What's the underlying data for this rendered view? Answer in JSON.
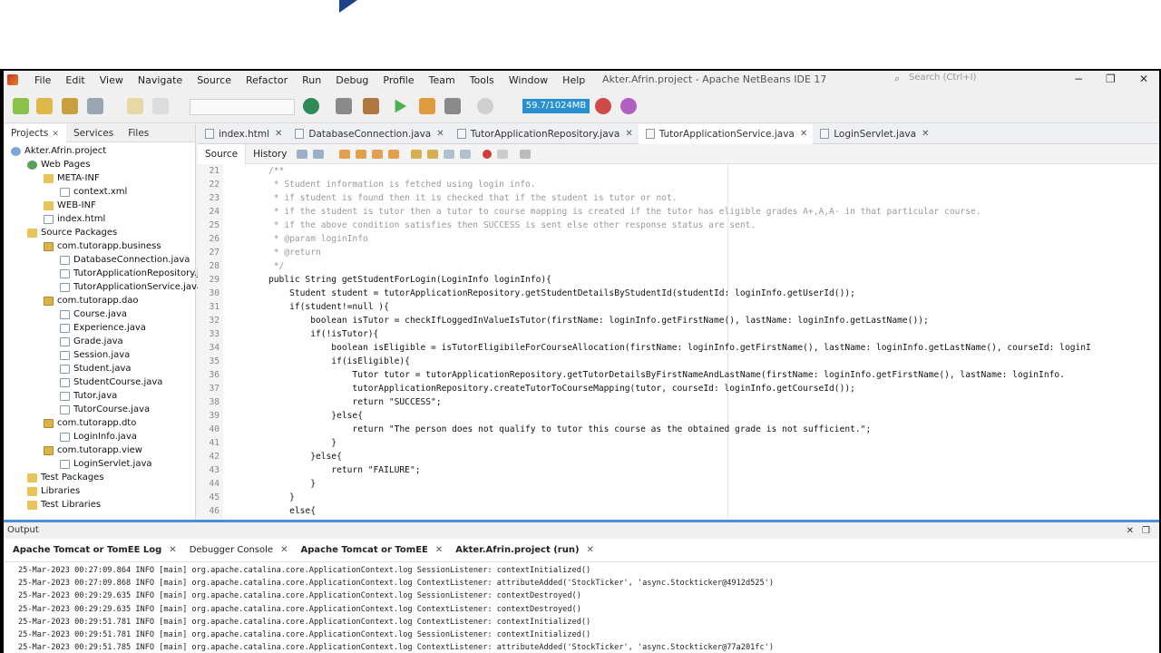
{
  "window": {
    "title": "Akter.Afrin.project - Apache NetBeans IDE 17",
    "search_placeholder": "Search (Ctrl+I)",
    "minimize": "−",
    "maximize": "❐",
    "close": "✕"
  },
  "menu": [
    "File",
    "Edit",
    "View",
    "Navigate",
    "Source",
    "Refactor",
    "Run",
    "Debug",
    "Profile",
    "Team",
    "Tools",
    "Window",
    "Help"
  ],
  "toolbar": {
    "memory": "59.7/1024MB"
  },
  "projects_panel": {
    "tabs": [
      "Projects",
      "Services",
      "Files"
    ],
    "tree": [
      {
        "label": "Akter.Afrin.project",
        "icon": "proj"
      },
      {
        "label": "Web Pages",
        "icon": "web"
      },
      {
        "label": "META-INF",
        "icon": "folder"
      },
      {
        "label": "context.xml",
        "icon": "file"
      },
      {
        "label": "WEB-INF",
        "icon": "folder"
      },
      {
        "label": "index.html",
        "icon": "file"
      },
      {
        "label": "Source Packages",
        "icon": "folder"
      },
      {
        "label": "com.tutorapp.business",
        "icon": "pkg"
      },
      {
        "label": "DatabaseConnection.java",
        "icon": "file"
      },
      {
        "label": "TutorApplicationRepository.ja",
        "icon": "file"
      },
      {
        "label": "TutorApplicationService.java",
        "icon": "file"
      },
      {
        "label": "com.tutorapp.dao",
        "icon": "pkg"
      },
      {
        "label": "Course.java",
        "icon": "file"
      },
      {
        "label": "Experience.java",
        "icon": "file"
      },
      {
        "label": "Grade.java",
        "icon": "file"
      },
      {
        "label": "Session.java",
        "icon": "file"
      },
      {
        "label": "Student.java",
        "icon": "file"
      },
      {
        "label": "StudentCourse.java",
        "icon": "file"
      },
      {
        "label": "Tutor.java",
        "icon": "file"
      },
      {
        "label": "TutorCourse.java",
        "icon": "file"
      },
      {
        "label": "com.tutorapp.dto",
        "icon": "pkg"
      },
      {
        "label": "LoginInfo.java",
        "icon": "file"
      },
      {
        "label": "com.tutorapp.view",
        "icon": "pkg"
      },
      {
        "label": "LoginServlet.java",
        "icon": "file"
      },
      {
        "label": "Test Packages",
        "icon": "folder"
      },
      {
        "label": "Libraries",
        "icon": "folder"
      },
      {
        "label": "Test Libraries",
        "icon": "folder"
      }
    ]
  },
  "editor": {
    "tabs": [
      "index.html",
      "DatabaseConnection.java",
      "TutorApplicationRepository.java",
      "TutorApplicationService.java",
      "LoginServlet.java"
    ],
    "active_tab": 3,
    "source_label": "Source",
    "history_label": "History",
    "lines": [
      {
        "n": "21",
        "t": "/**",
        "c": true
      },
      {
        "n": "22",
        "t": " * Student information is fetched using login info.",
        "c": true
      },
      {
        "n": "23",
        "t": " * if student is found then it is checked that if the student is tutor or not.",
        "c": true
      },
      {
        "n": "24",
        "t": " * if the student is tutor then a tutor to course mapping is created if the tutor has eligible grades A+,A,A- in that particular course.",
        "c": true
      },
      {
        "n": "25",
        "t": " * if the above condition satisfies then SUCCESS is sent else other response status are sent.",
        "c": true
      },
      {
        "n": "26",
        "t": " * @param loginInfo",
        "c": true
      },
      {
        "n": "27",
        "t": " * @return",
        "c": true
      },
      {
        "n": "28",
        "t": " */",
        "c": true
      },
      {
        "n": "29",
        "t": "public String getStudentForLogin(LoginInfo loginInfo){",
        "c": false
      },
      {
        "n": "30",
        "t": "    Student student = tutorApplicationRepository.getStudentDetailsByStudentId(studentId: loginInfo.getUserId());",
        "c": false
      },
      {
        "n": "31",
        "t": "    if(student!=null ){",
        "c": false
      },
      {
        "n": "32",
        "t": "        boolean isTutor = checkIfLoggedInValueIsTutor(firstName: loginInfo.getFirstName(), lastName: loginInfo.getLastName());",
        "c": false
      },
      {
        "n": "33",
        "t": "        if(!isTutor){",
        "c": false
      },
      {
        "n": "34",
        "t": "            boolean isEligible = isTutorEligibileForCourseAllocation(firstName: loginInfo.getFirstName(), lastName: loginInfo.getLastName(), courseId: loginI",
        "c": false
      },
      {
        "n": "35",
        "t": "            if(isEligible){",
        "c": false
      },
      {
        "n": "36",
        "t": "                Tutor tutor = tutorApplicationRepository.getTutorDetailsByFirstNameAndLastName(firstName: loginInfo.getFirstName(), lastName: loginInfo.",
        "c": false
      },
      {
        "n": "37",
        "t": "                tutorApplicationRepository.createTutorToCourseMapping(tutor, courseId: loginInfo.getCourseId());",
        "c": false
      },
      {
        "n": "38",
        "t": "                return \"SUCCESS\";",
        "c": false
      },
      {
        "n": "39",
        "t": "            }else{",
        "c": false
      },
      {
        "n": "40",
        "t": "                return \"The person does not qualify to tutor this course as the obtained grade is not sufficient.\";",
        "c": false
      },
      {
        "n": "41",
        "t": "            }",
        "c": false
      },
      {
        "n": "42",
        "t": "        }else{",
        "c": false
      },
      {
        "n": "43",
        "t": "            return \"FAILURE\";",
        "c": false
      },
      {
        "n": "44",
        "t": "        }",
        "c": false
      },
      {
        "n": "45",
        "t": "    }",
        "c": false
      },
      {
        "n": "46",
        "t": "    else{",
        "c": false
      }
    ]
  },
  "output": {
    "label": "Output",
    "tabs": [
      "Apache Tomcat or TomEE Log",
      "Debugger Console",
      "Apache Tomcat or TomEE",
      "Akter.Afrin.project (run)"
    ],
    "log": [
      "25-Mar-2023 00:27:09.864 INFO [main] org.apache.catalina.core.ApplicationContext.log SessionListener: contextInitialized()",
      "25-Mar-2023 00:27:09.868 INFO [main] org.apache.catalina.core.ApplicationContext.log ContextListener: attributeAdded('StockTicker', 'async.Stockticker@4912d525')",
      "25-Mar-2023 00:29:29.635 INFO [main] org.apache.catalina.core.ApplicationContext.log SessionListener: contextDestroyed()",
      "25-Mar-2023 00:29:29.635 INFO [main] org.apache.catalina.core.ApplicationContext.log ContextListener: contextDestroyed()",
      "25-Mar-2023 00:29:51.781 INFO [main] org.apache.catalina.core.ApplicationContext.log ContextListener: contextInitialized()",
      "25-Mar-2023 00:29:51.781 INFO [main] org.apache.catalina.core.ApplicationContext.log SessionListener: contextInitialized()",
      "25-Mar-2023 00:29:51.785 INFO [main] org.apache.catalina.core.ApplicationContext.log ContextListener: attributeAdded('StockTicker', 'async.Stockticker@77a201fc')"
    ]
  },
  "colors": {
    "accent": "#4a90d9",
    "memory_bar": "#2a8fcf",
    "brand_triangle": "#1e3f8a"
  }
}
